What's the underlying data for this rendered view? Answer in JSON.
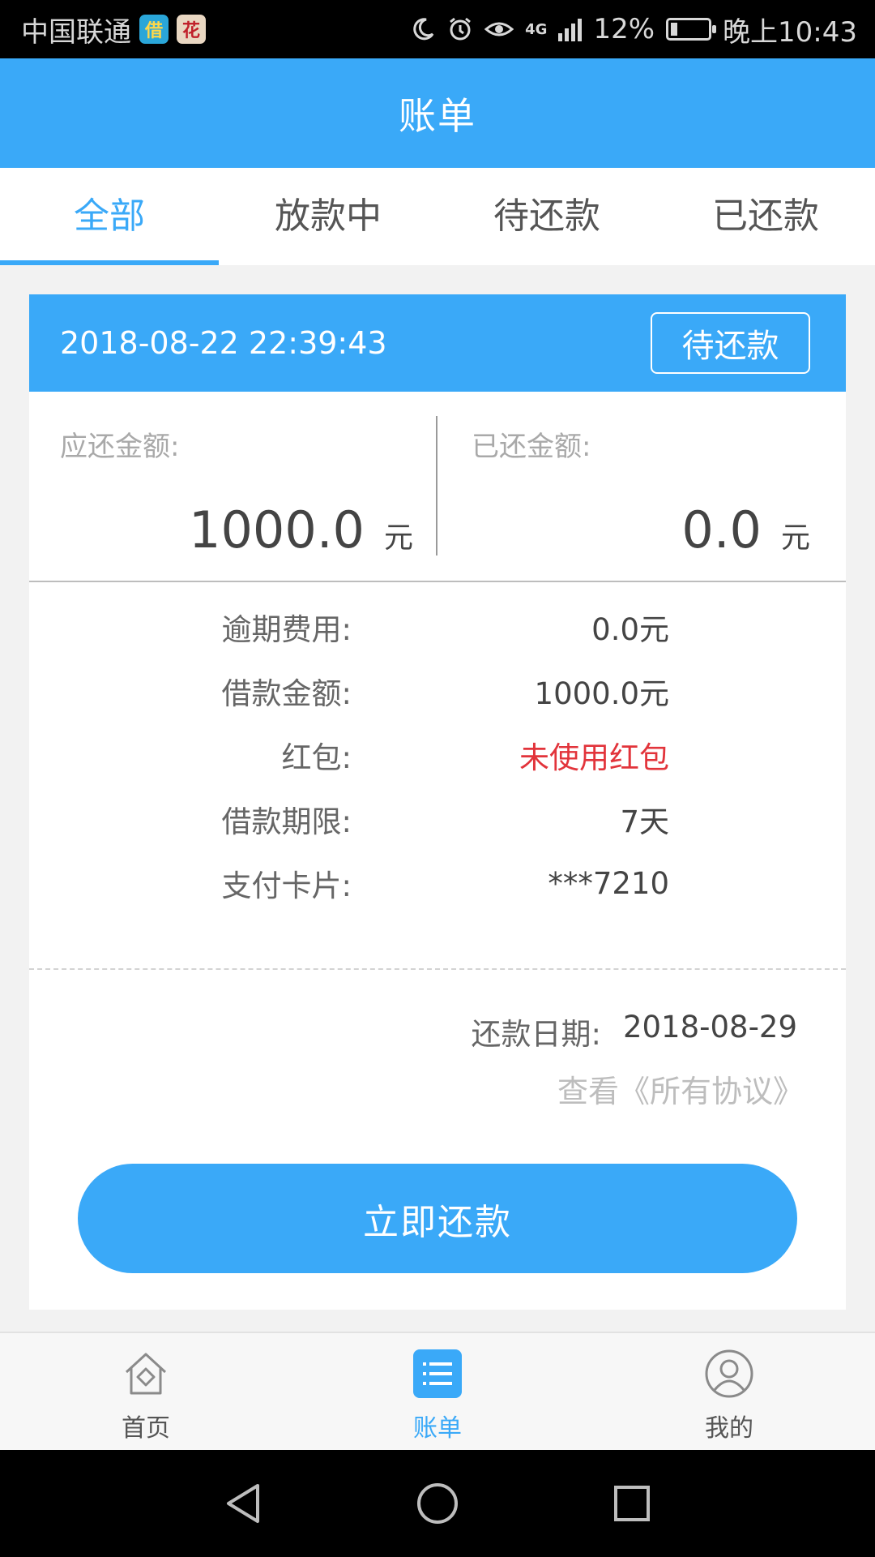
{
  "status_bar": {
    "carrier": "中国联通",
    "app_icon_1": "借",
    "app_icon_2": "花",
    "network": "4G",
    "battery": "12%",
    "time": "晚上10:43"
  },
  "header": {
    "title": "账单"
  },
  "tabs": [
    {
      "label": "全部",
      "active": true
    },
    {
      "label": "放款中",
      "active": false
    },
    {
      "label": "待还款",
      "active": false
    },
    {
      "label": "已还款",
      "active": false
    }
  ],
  "bill": {
    "datetime": "2018-08-22 22:39:43",
    "status": "待还款",
    "due_amount_label": "应还金额:",
    "due_amount": "1000.0",
    "due_amount_unit": "元",
    "paid_amount_label": "已还金额:",
    "paid_amount": "0.0",
    "paid_amount_unit": "元",
    "details": [
      {
        "label": "逾期费用:",
        "value": "0.0元"
      },
      {
        "label": "借款金额:",
        "value": "1000.0元"
      },
      {
        "label": "红包:",
        "value": "未使用红包",
        "highlight": true
      },
      {
        "label": "借款期限:",
        "value": "7天"
      },
      {
        "label": "支付卡片:",
        "value": "***7210"
      }
    ],
    "repay_date_label": "还款日期:",
    "repay_date": "2018-08-29",
    "agreement_link": "查看《所有协议》",
    "pay_button": "立即还款"
  },
  "bottom_nav": [
    {
      "label": "首页",
      "icon": "home-icon",
      "active": false
    },
    {
      "label": "账单",
      "icon": "bill-list-icon",
      "active": true
    },
    {
      "label": "我的",
      "icon": "user-icon",
      "active": false
    }
  ],
  "colors": {
    "primary": "#3aa9f8",
    "highlight_red": "#e2343b"
  }
}
